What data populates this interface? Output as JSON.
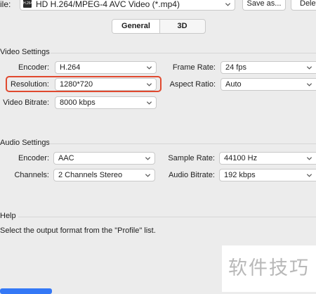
{
  "topbar": {
    "profile_label": "ile:",
    "format_icon_text": "H.264",
    "profile_value": "HD H.264/MPEG-4 AVC Video (*.mp4)",
    "save_as": "Save as...",
    "delete": "Delet"
  },
  "tabs": [
    {
      "label": "General",
      "active": true
    },
    {
      "label": "3D",
      "active": false
    }
  ],
  "video_settings": {
    "title": "Video Settings",
    "encoder_label": "Encoder:",
    "encoder_value": "H.264",
    "frame_rate_label": "Frame Rate:",
    "frame_rate_value": "24 fps",
    "resolution_label": "Resolution:",
    "resolution_value": "1280*720",
    "aspect_ratio_label": "Aspect Ratio:",
    "aspect_ratio_value": "Auto",
    "video_bitrate_label": "Video Bitrate:",
    "video_bitrate_value": "8000 kbps"
  },
  "audio_settings": {
    "title": "Audio Settings",
    "encoder_label": "Encoder:",
    "encoder_value": "AAC",
    "sample_rate_label": "Sample Rate:",
    "sample_rate_value": "44100 Hz",
    "channels_label": "Channels:",
    "channels_value": "2 Channels Stereo",
    "audio_bitrate_label": "Audio Bitrate:",
    "audio_bitrate_value": "192 kbps"
  },
  "help": {
    "title": "Help",
    "text": "Select the output format from the \"Profile\" list."
  },
  "watermark": "软件技巧",
  "colors": {
    "background": "#ececec",
    "highlight": "#e0492f",
    "accent": "#3478f6"
  }
}
